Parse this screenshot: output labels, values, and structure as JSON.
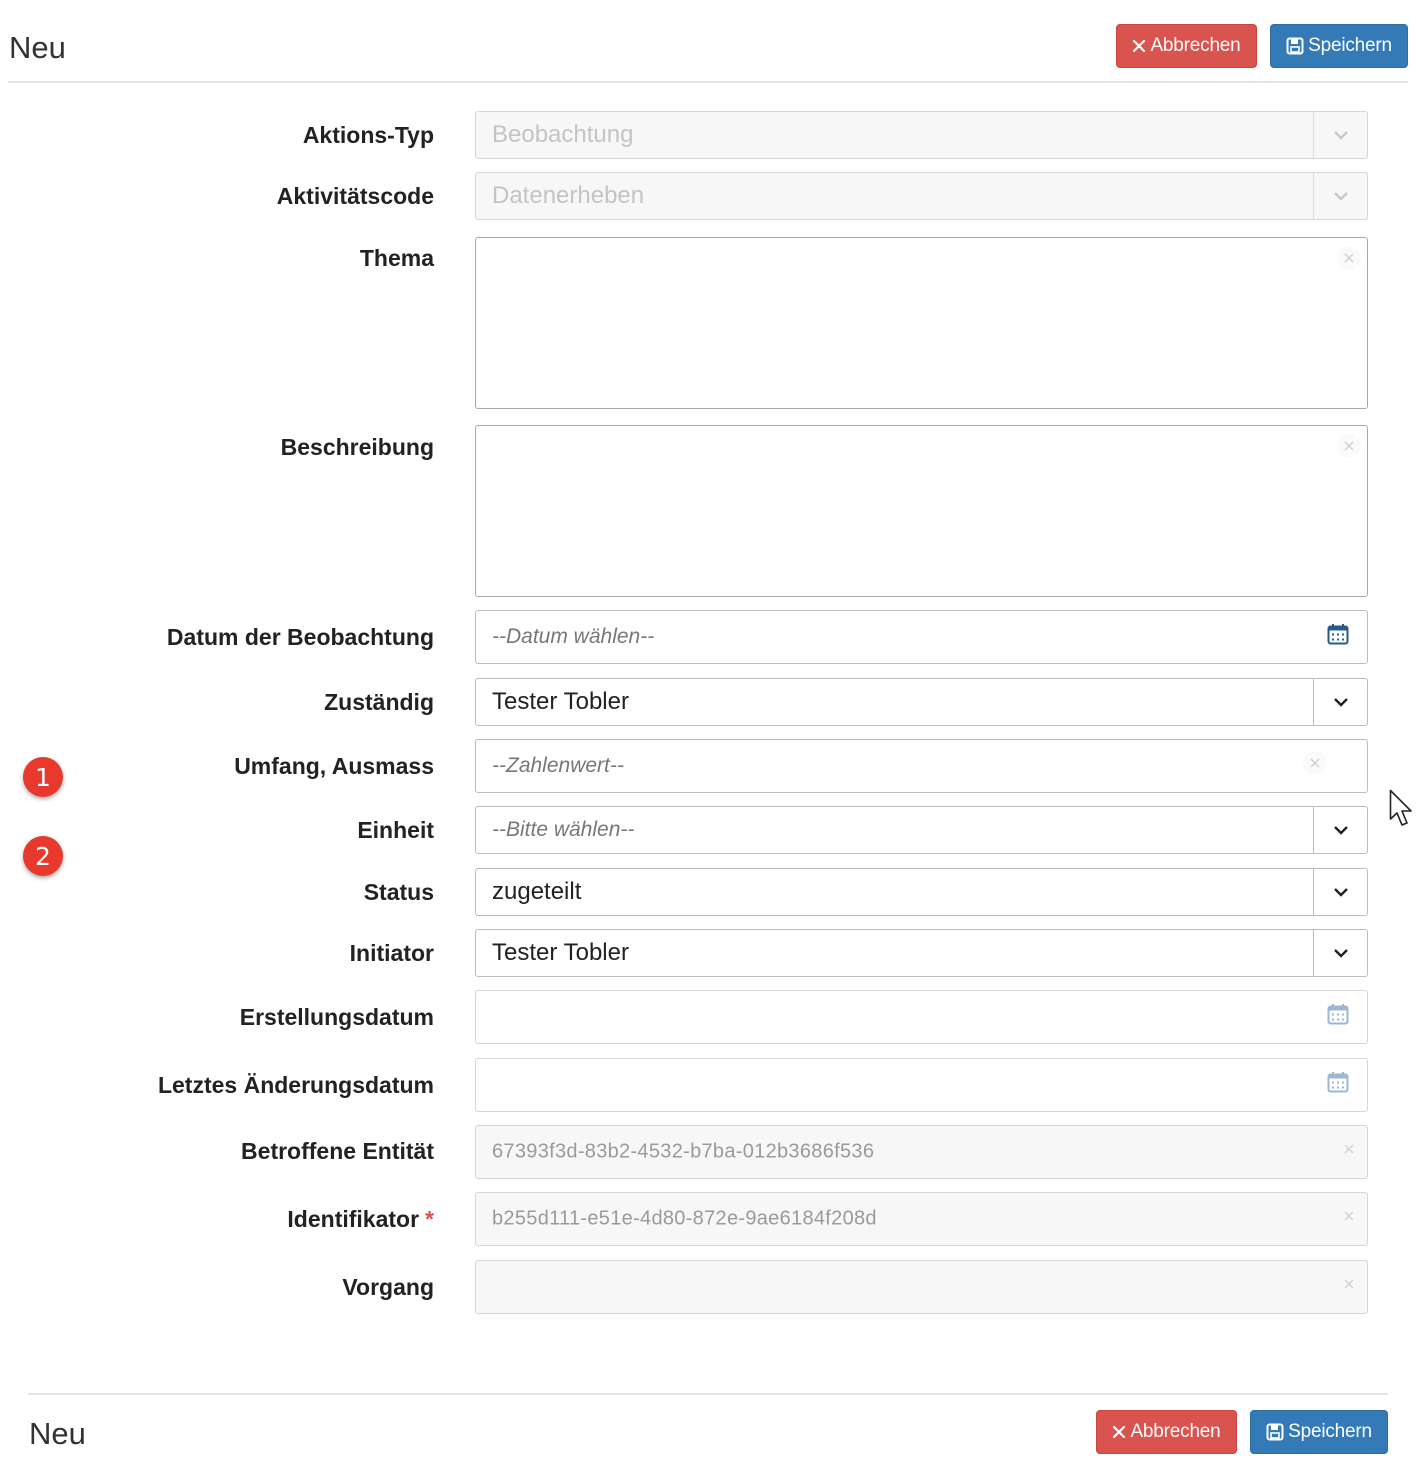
{
  "header": {
    "title": "Neu",
    "cancel_label": "Abbrechen",
    "save_label": "Speichern"
  },
  "form": {
    "aktionstyp": {
      "label": "Aktions-Typ",
      "value": "Beobachtung"
    },
    "aktivitaetscode": {
      "label": "Aktivitätscode",
      "value": "Datenerheben"
    },
    "thema": {
      "label": "Thema",
      "value": ""
    },
    "beschreibung": {
      "label": "Beschreibung",
      "value": ""
    },
    "datum_beobachtung": {
      "label": "Datum der Beobachtung",
      "placeholder": "--Datum wählen--"
    },
    "zustaendig": {
      "label": "Zuständig",
      "value": "Tester Tobler"
    },
    "umfang": {
      "label": "Umfang, Ausmass",
      "placeholder": "--Zahlenwert--"
    },
    "einheit": {
      "label": "Einheit",
      "placeholder": "--Bitte wählen--"
    },
    "status": {
      "label": "Status",
      "value": "zugeteilt"
    },
    "initiator": {
      "label": "Initiator",
      "value": "Tester Tobler"
    },
    "erstellungsdatum": {
      "label": "Erstellungsdatum",
      "value": ""
    },
    "letztes_aenderungsdatum": {
      "label": "Letztes Änderungsdatum",
      "value": ""
    },
    "betroffene_entitaet": {
      "label": "Betroffene Entität",
      "value": "67393f3d-83b2-4532-b7ba-012b3686f536"
    },
    "identifikator": {
      "label": "Identifikator",
      "required_mark": "*",
      "value": "b255d111-e51e-4d80-872e-9ae6184f208d"
    },
    "vorgang": {
      "label": "Vorgang",
      "value": ""
    }
  },
  "annotations": {
    "badge_1": "1",
    "badge_2": "2"
  },
  "footer": {
    "title": "Neu",
    "cancel_label": "Abbrechen",
    "save_label": "Speichern"
  },
  "icons": {
    "cancel": "close-icon",
    "save": "floppy-disk-icon",
    "dropdown": "chevron-down-icon",
    "calendar": "calendar-icon",
    "clear": "clear-icon",
    "cursor": "mouse-pointer-icon"
  },
  "colors": {
    "cancel": "#d9534f",
    "save": "#337ab7",
    "badge": "#e8392f",
    "required": "#d9534f"
  }
}
